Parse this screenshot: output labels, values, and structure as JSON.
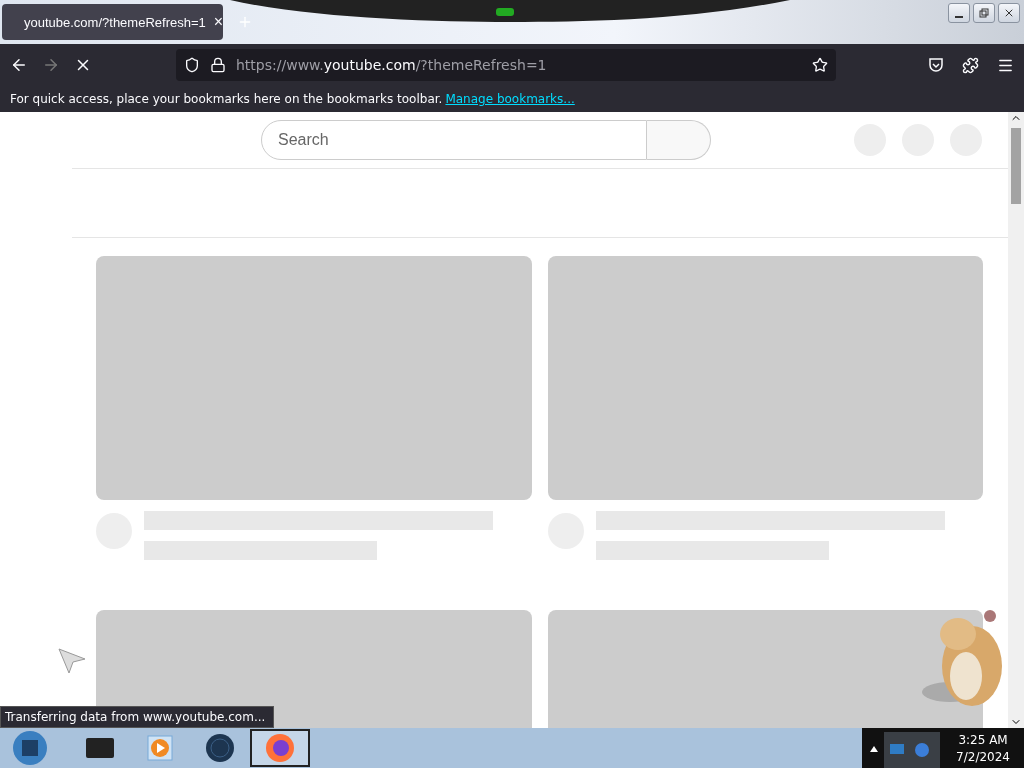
{
  "tabs": [
    {
      "title": "youtube.com/?themeRefresh=1",
      "selected": true,
      "close": "×"
    }
  ],
  "address": {
    "prefix": "https://www.",
    "domain": "youtube.com",
    "suffix": "/?themeRefresh=1"
  },
  "bookmarks_bar": {
    "message": "For quick access, place your bookmarks here on the bookmarks toolbar.",
    "link": "Manage bookmarks..."
  },
  "search": {
    "placeholder": "Search"
  },
  "status": "Transferring data from www.youtube.com...",
  "taskbar": {
    "apps": [
      {
        "kind": "terminal",
        "selected": false
      },
      {
        "kind": "player",
        "selected": false
      },
      {
        "kind": "globe",
        "selected": false
      },
      {
        "kind": "firefox",
        "selected": true
      }
    ],
    "time": "3:25 AM",
    "date": "7/2/2024"
  }
}
